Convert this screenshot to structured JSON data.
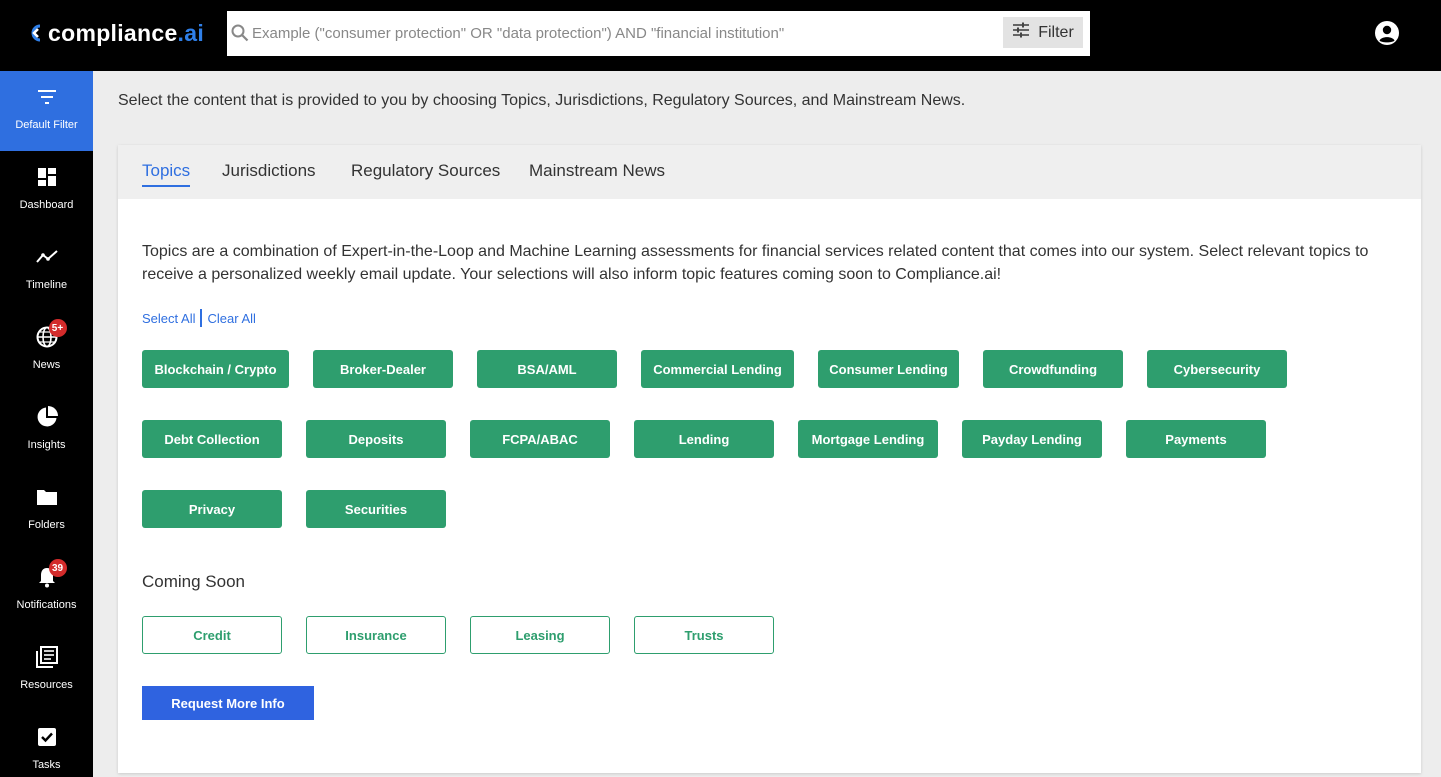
{
  "app": {
    "logo_text": "compliance",
    "logo_accent": ".ai",
    "brand_color": "#2f7fe8"
  },
  "search": {
    "placeholder": "Example (\"consumer protection\" OR \"data protection\") AND \"financial institution\"",
    "value": "",
    "filter_label": "Filter"
  },
  "sidebar": {
    "items": [
      {
        "label": "Default Filter",
        "icon": "filter-lines-icon",
        "active": true
      },
      {
        "label": "Dashboard",
        "icon": "dashboard-icon"
      },
      {
        "label": "Timeline",
        "icon": "timeline-icon"
      },
      {
        "label": "News",
        "icon": "globe-icon",
        "badge": "5+"
      },
      {
        "label": "Insights",
        "icon": "pie-chart-icon"
      },
      {
        "label": "Folders",
        "icon": "folder-icon"
      },
      {
        "label": "Notifications",
        "icon": "bell-icon",
        "badge": "39"
      },
      {
        "label": "Resources",
        "icon": "resources-icon"
      },
      {
        "label": "Tasks",
        "icon": "checkbox-icon"
      }
    ]
  },
  "main": {
    "intro": "Select the content that is provided to you by choosing Topics, Jurisdictions, Regulatory Sources, and Mainstream News.",
    "tabs": [
      {
        "label": "Topics",
        "active": true
      },
      {
        "label": "Jurisdictions"
      },
      {
        "label": "Regulatory Sources"
      },
      {
        "label": "Mainstream News"
      }
    ],
    "description": "Topics are a combination of Expert-in-the-Loop and Machine Learning assessments for financial services related content that comes into our system. Select relevant topics to receive a personalized weekly email update. Your selections will also inform topic features coming soon to Compliance.ai!",
    "select_all": "Select All",
    "clear_all": "Clear All",
    "topics": [
      "Blockchain / Crypto",
      "Broker-Dealer",
      "BSA/AML",
      "Commercial Lending",
      "Consumer Lending",
      "Crowdfunding",
      "Cybersecurity",
      "Debt Collection",
      "Deposits",
      "FCPA/ABAC",
      "Lending",
      "Mortgage Lending",
      "Payday Lending",
      "Payments",
      "Privacy",
      "Securities"
    ],
    "coming_soon_title": "Coming Soon",
    "coming_soon": [
      "Credit",
      "Insurance",
      "Leasing",
      "Trusts"
    ],
    "request_button": "Request More Info",
    "colors": {
      "topic_green": "#2e9e6e",
      "active_blue": "#2f6fe0",
      "request_blue": "#2f63e0",
      "badge_red": "#d32b2b"
    }
  }
}
